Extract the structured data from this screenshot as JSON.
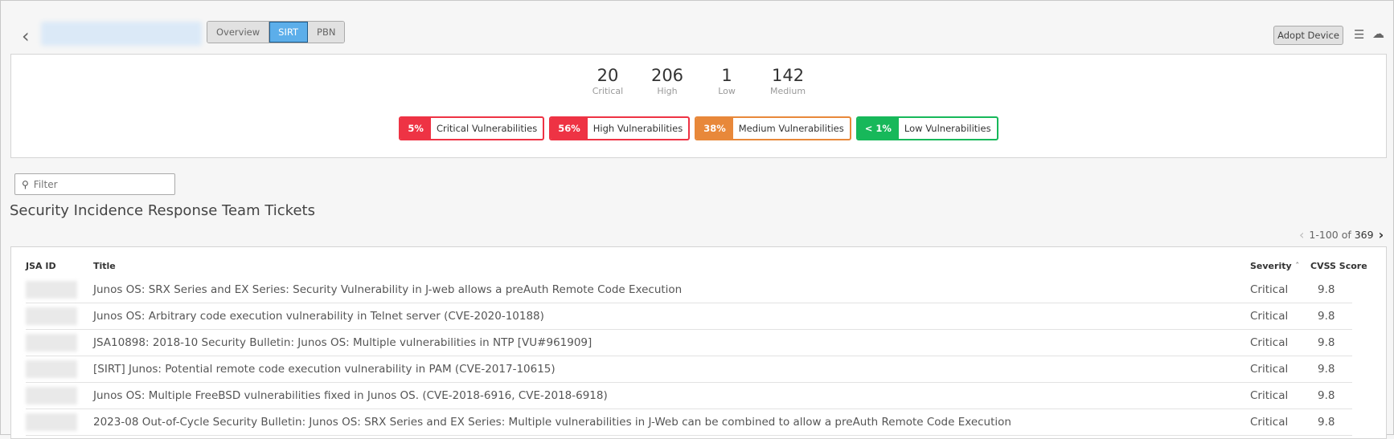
{
  "header": {
    "tabs": [
      "Overview",
      "SIRT",
      "PBN"
    ],
    "active_tab": "SIRT",
    "adopt_label": "Adopt Device"
  },
  "stats": [
    {
      "n": "20",
      "l": "Critical"
    },
    {
      "n": "206",
      "l": "High"
    },
    {
      "n": "1",
      "l": "Low"
    },
    {
      "n": "142",
      "l": "Medium"
    }
  ],
  "badges": [
    {
      "pct": "5%",
      "label": "Critical Vulnerabilities",
      "color": "#ee3344"
    },
    {
      "pct": "56%",
      "label": "High Vulnerabilities",
      "color": "#ee3344"
    },
    {
      "pct": "38%",
      "label": "Medium Vulnerabilities",
      "color": "#e8883a"
    },
    {
      "pct": "< 1%",
      "label": "Low Vulnerabilities",
      "color": "#17b85a"
    }
  ],
  "filter": {
    "placeholder": "Filter"
  },
  "section_title": "Security Incidence Response Team Tickets",
  "pagination": {
    "range": "1-100 of",
    "total": "369"
  },
  "table": {
    "columns": [
      "JSA ID",
      "Title",
      "Severity",
      "CVSS Score"
    ],
    "rows": [
      {
        "title": "Junos OS: SRX Series and EX Series: Security Vulnerability in J-web allows a preAuth Remote Code Execution",
        "severity": "Critical",
        "cvss": "9.8"
      },
      {
        "title": "Junos OS: Arbitrary code execution vulnerability in Telnet server (CVE-2020-10188)",
        "severity": "Critical",
        "cvss": "9.8"
      },
      {
        "title": "JSA10898: 2018-10 Security Bulletin: Junos OS: Multiple vulnerabilities in NTP [VU#961909]",
        "severity": "Critical",
        "cvss": "9.8"
      },
      {
        "title": "[SIRT] Junos: Potential remote code execution vulnerability in PAM (CVE-2017-10615)",
        "severity": "Critical",
        "cvss": "9.8"
      },
      {
        "title": "Junos OS: Multiple FreeBSD vulnerabilities fixed in Junos OS. (CVE-2018-6916, CVE-2018-6918)",
        "severity": "Critical",
        "cvss": "9.8"
      },
      {
        "title": "2023-08 Out-of-Cycle Security Bulletin: Junos OS: SRX Series and EX Series: Multiple vulnerabilities in J-Web can be combined to allow a preAuth Remote Code Execution",
        "severity": "Critical",
        "cvss": "9.8"
      }
    ]
  }
}
